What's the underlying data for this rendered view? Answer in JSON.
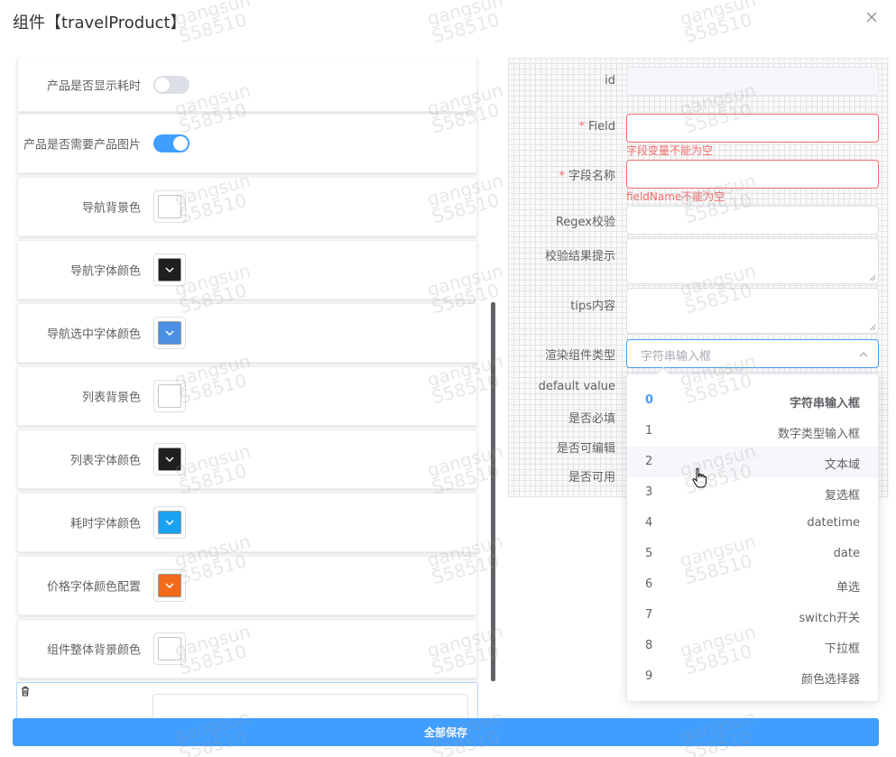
{
  "dialog": {
    "title": "组件【travelProduct】"
  },
  "left_cards": [
    {
      "label": "产品是否显示耗时",
      "control": "switch",
      "state": "off"
    },
    {
      "label": "产品是否需要产品图片",
      "control": "switch",
      "state": "on"
    },
    {
      "label": "导航背景色",
      "control": "color",
      "color": ""
    },
    {
      "label": "导航字体颜色",
      "control": "color",
      "color": "#1f1f1f"
    },
    {
      "label": "导航选中字体颜色",
      "control": "color",
      "color": "#4a90e2"
    },
    {
      "label": "列表背景色",
      "control": "color",
      "color": ""
    },
    {
      "label": "列表字体颜色",
      "control": "color",
      "color": "#1f1f1f"
    },
    {
      "label": "耗时字体颜色",
      "control": "color",
      "color": "#1aa3f0"
    },
    {
      "label": "价格字体颜色配置",
      "control": "color",
      "color": "#f26b1d"
    },
    {
      "label": "组件整体背景颜色",
      "control": "color",
      "color": ""
    }
  ],
  "form": {
    "id_label": "id",
    "field_label": "Field",
    "field_error": "字段变量不能为空",
    "name_label": "字段名称",
    "name_error": "fieldName不能为空",
    "regex_label": "Regex校验",
    "result_tip_label": "校验结果提示",
    "tips_label": "tips内容",
    "render_type_label": "渲染组件类型",
    "render_type_placeholder": "字符串输入框",
    "default_value_label": "default value",
    "required_label": "是否必填",
    "editable_label": "是否可编辑",
    "enabled_label": "是否可用"
  },
  "dropdown_options": [
    {
      "index": "0",
      "name": "字符串输入框"
    },
    {
      "index": "1",
      "name": "数字类型输入框"
    },
    {
      "index": "2",
      "name": "文本域"
    },
    {
      "index": "3",
      "name": "复选框"
    },
    {
      "index": "4",
      "name": "datetime"
    },
    {
      "index": "5",
      "name": "date"
    },
    {
      "index": "6",
      "name": "单选"
    },
    {
      "index": "7",
      "name": "switch开关"
    },
    {
      "index": "8",
      "name": "下拉框"
    },
    {
      "index": "9",
      "name": "颜色选择器"
    }
  ],
  "footer": {
    "save_label": "全部保存"
  },
  "watermark": {
    "line1": "gangsun",
    "line2": "S58510"
  },
  "colors": {
    "primary": "#409eff",
    "error": "#f56c6c"
  }
}
